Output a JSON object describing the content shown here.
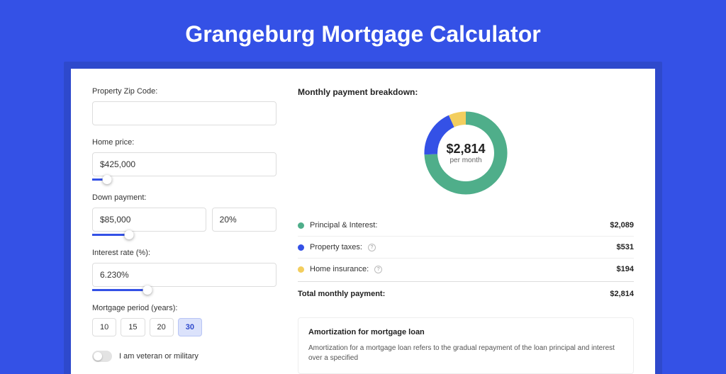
{
  "title": "Grangeburg Mortgage Calculator",
  "form": {
    "zip": {
      "label": "Property Zip Code:",
      "value": ""
    },
    "homePrice": {
      "label": "Home price:",
      "value": "$425,000",
      "sliderPct": 8
    },
    "downPayment": {
      "label": "Down payment:",
      "amount": "$85,000",
      "percent": "20%",
      "sliderPct": 20
    },
    "interestRate": {
      "label": "Interest rate (%):",
      "value": "6.230%",
      "sliderPct": 30
    },
    "period": {
      "label": "Mortgage period (years):",
      "options": [
        "10",
        "15",
        "20",
        "30"
      ],
      "activeIndex": 3
    },
    "veteran": {
      "label": "I am veteran or military",
      "on": false
    }
  },
  "breakdown": {
    "title": "Monthly payment breakdown:",
    "donut": {
      "amount": "$2,814",
      "sub": "per month"
    },
    "items": [
      {
        "label": "Principal & Interest:",
        "value": "$2,089",
        "color": "#4fae8a",
        "info": false
      },
      {
        "label": "Property taxes:",
        "value": "$531",
        "color": "#3451e6",
        "info": true
      },
      {
        "label": "Home insurance:",
        "value": "$194",
        "color": "#f3ce5e",
        "info": true
      }
    ],
    "total": {
      "label": "Total monthly payment:",
      "value": "$2,814"
    }
  },
  "amort": {
    "title": "Amortization for mortgage loan",
    "text": "Amortization for a mortgage loan refers to the gradual repayment of the loan principal and interest over a specified"
  },
  "chart_data": {
    "type": "pie",
    "title": "Monthly payment breakdown",
    "categories": [
      "Principal & Interest",
      "Property taxes",
      "Home insurance"
    ],
    "values": [
      2089,
      531,
      194
    ],
    "colors": [
      "#4fae8a",
      "#3451e6",
      "#f3ce5e"
    ],
    "total": 2814,
    "center_label": "$2,814 per month"
  }
}
